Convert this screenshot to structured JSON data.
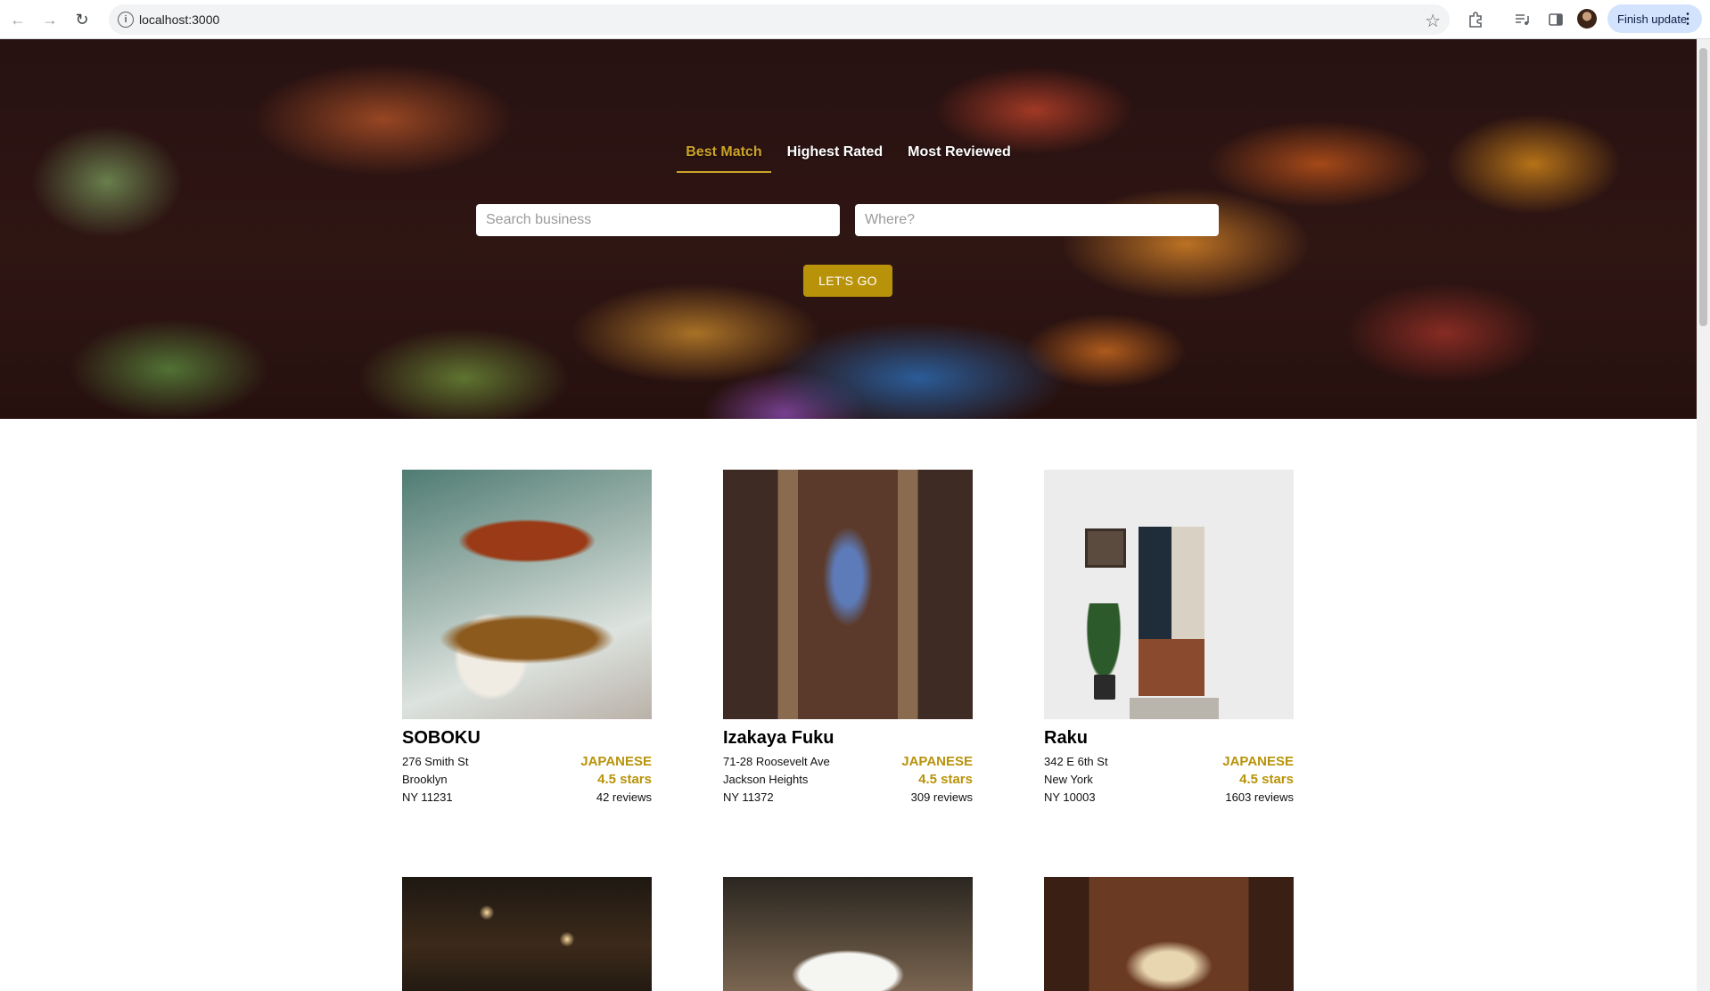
{
  "browser": {
    "url": "localhost:3000",
    "finish_update_label": "Finish update",
    "icons": {
      "back": "arrow-left-icon",
      "forward": "arrow-right-icon",
      "reload": "reload-icon",
      "site_info": "info-icon",
      "bookmark": "star-icon",
      "extensions": "puzzle-icon",
      "media": "media-queue-icon",
      "side_panel": "side-panel-icon",
      "menu": "kebab-menu-icon"
    }
  },
  "hero": {
    "sort_options": [
      {
        "label": "Best Match",
        "active": true
      },
      {
        "label": "Highest Rated",
        "active": false
      },
      {
        "label": "Most Reviewed",
        "active": false
      }
    ],
    "search": {
      "term_placeholder": "Search business",
      "term_value": "",
      "location_placeholder": "Where?",
      "location_value": ""
    },
    "submit_label": "LET'S GO"
  },
  "colors": {
    "accent": "#b8930a",
    "active_tab": "#cca329"
  },
  "businesses": [
    {
      "name": "SOBOKU",
      "address": "276 Smith St",
      "city": "Brooklyn",
      "state_zip": "NY 11231",
      "category": "JAPANESE",
      "rating": "4.5 stars",
      "reviews": "42 reviews"
    },
    {
      "name": "Izakaya Fuku",
      "address": "71-28 Roosevelt Ave",
      "city": "Jackson Heights",
      "state_zip": "NY 11372",
      "category": "JAPANESE",
      "rating": "4.5 stars",
      "reviews": "309 reviews"
    },
    {
      "name": "Raku",
      "address": "342 E 6th St",
      "city": "New York",
      "state_zip": "NY 10003",
      "category": "JAPANESE",
      "rating": "4.5 stars",
      "reviews": "1603 reviews"
    }
  ]
}
